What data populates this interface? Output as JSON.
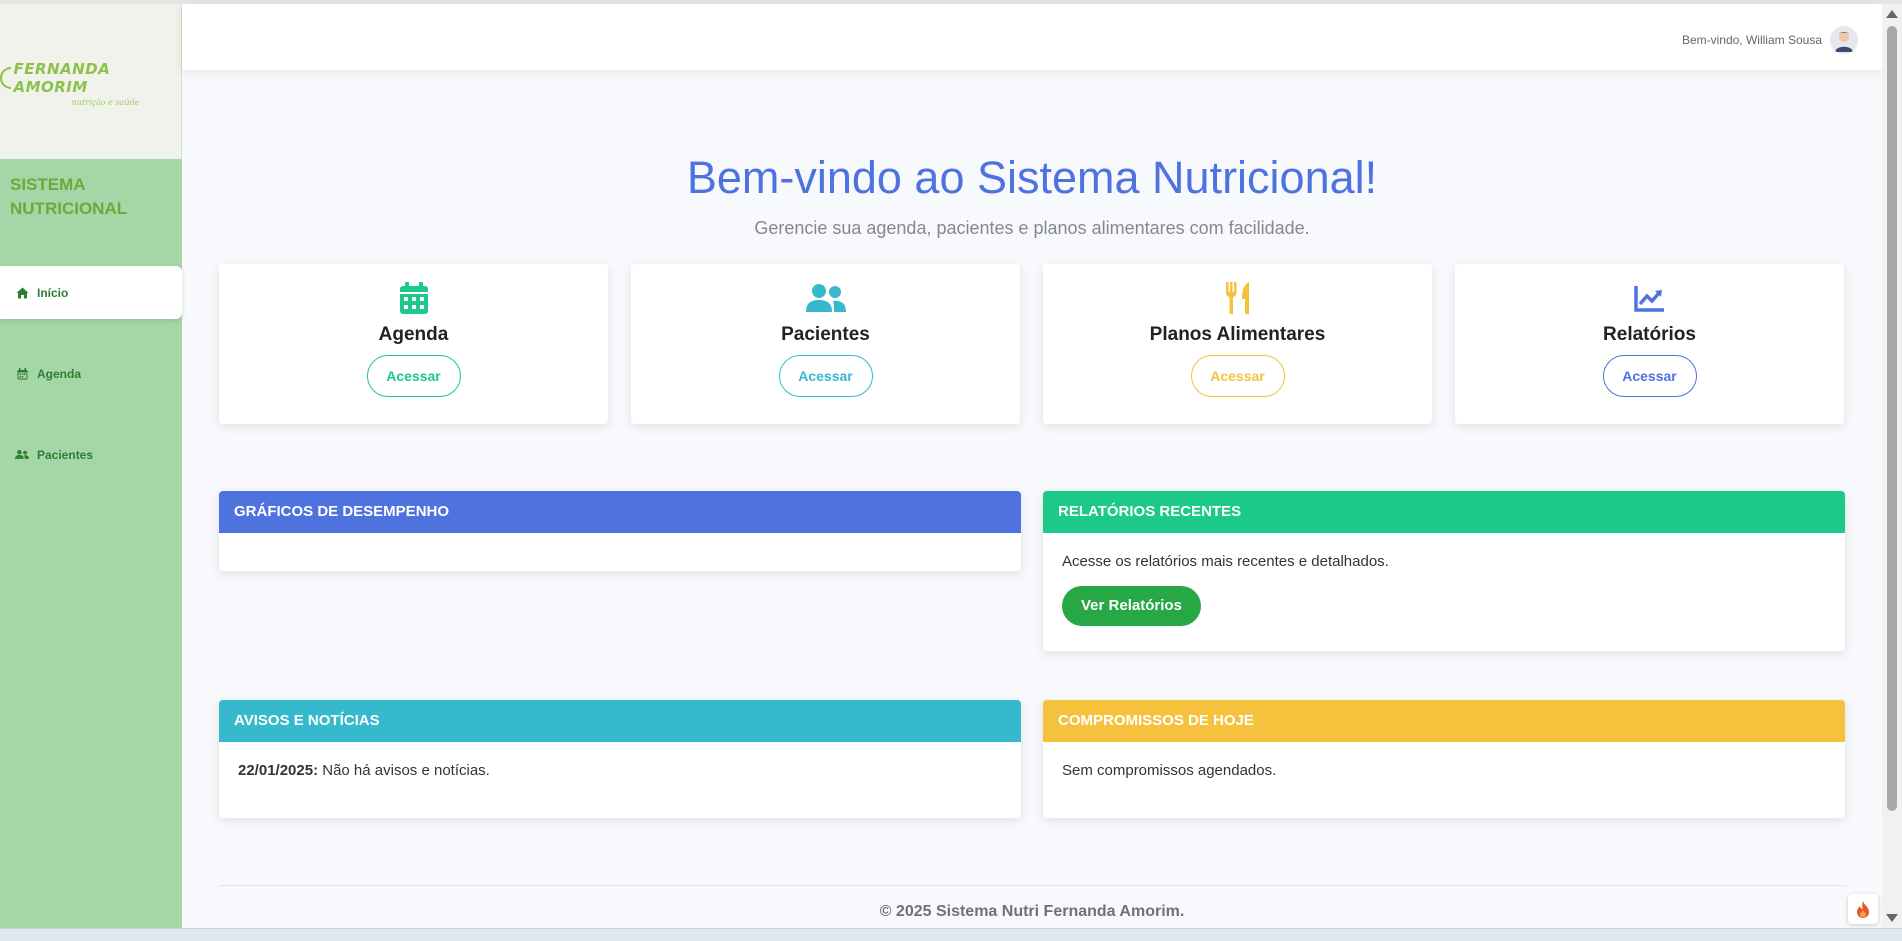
{
  "logo": {
    "name": "FERNANDA AMORIM",
    "tagline": "nutrição e saúde"
  },
  "sidebar": {
    "brand": "SISTEMA NUTRICIONAL",
    "items": [
      {
        "label": "Início",
        "icon": "home-icon",
        "active": true
      },
      {
        "label": "Agenda",
        "icon": "calendar-icon",
        "active": false
      },
      {
        "label": "Pacientes",
        "icon": "users-icon",
        "active": false
      }
    ]
  },
  "topbar": {
    "greeting": "Bem-vindo, William Sousa"
  },
  "welcome": {
    "title": "Bem-vindo ao Sistema Nutricional!",
    "subtitle": "Gerencie sua agenda, pacientes e planos alimentares com facilidade."
  },
  "cards": [
    {
      "title": "Agenda",
      "button": "Acessar",
      "icon": "calendar-icon",
      "color": "#1cc88a"
    },
    {
      "title": "Pacientes",
      "button": "Acessar",
      "icon": "users-icon",
      "color": "#36b9cc"
    },
    {
      "title": "Planos Alimentares",
      "button": "Acessar",
      "icon": "utensils-icon",
      "color": "#f6c23e"
    },
    {
      "title": "Relatórios",
      "button": "Acessar",
      "icon": "chart-line-icon",
      "color": "#4e73df"
    }
  ],
  "panels": {
    "charts": {
      "header": "GRÁFICOS DE DESEMPENHO",
      "color": "#4e73df"
    },
    "reports": {
      "header": "RELATÓRIOS RECENTES",
      "color": "#1cc88a",
      "text": "Acesse os relatórios mais recentes e detalhados.",
      "button": "Ver Relatórios"
    },
    "news": {
      "header": "AVISOS E NOTÍCIAS",
      "color": "#36b9cc",
      "date": "22/01/2025:",
      "text": "Não há avisos e notícias."
    },
    "appointments": {
      "header": "COMPROMISSOS DE HOJE",
      "color": "#f6c23e",
      "text": "Sem compromissos agendados."
    }
  },
  "footer": {
    "text": "© 2025 Sistema Nutri Fernanda Amorim."
  }
}
